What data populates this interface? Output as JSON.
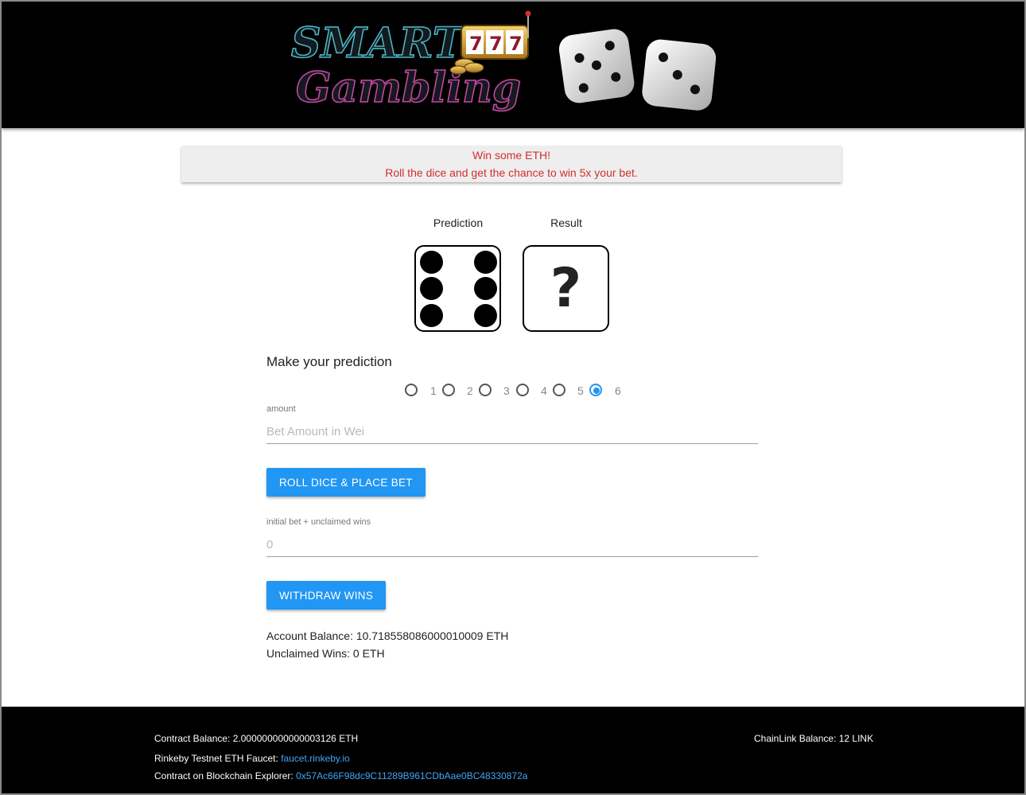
{
  "header": {
    "logo_line1": "SMART",
    "logo_line2": "Gambling",
    "slot_digits": "777",
    "dice_count": 2
  },
  "banner": {
    "line1": "Win some ETH!",
    "line2": "Roll the dice and get the chance to win 5x your bet.",
    "color": "#d32f2f"
  },
  "dice": {
    "prediction_label": "Prediction",
    "result_label": "Result",
    "prediction_value": 6,
    "result_value": "?"
  },
  "prediction": {
    "title": "Make your prediction",
    "options": [
      "1",
      "2",
      "3",
      "4",
      "5",
      "6"
    ],
    "selected": "6",
    "accent": "#2196f3"
  },
  "amount": {
    "label": "amount",
    "placeholder": "Bet Amount in Wei",
    "value": ""
  },
  "roll_button": {
    "label": "ROLL DICE & PLACE BET"
  },
  "wins_field": {
    "label": "initial bet + unclaimed wins",
    "placeholder": "0",
    "value": ""
  },
  "withdraw_button": {
    "label": "WITHDRAW WINS"
  },
  "account": {
    "balance": "Account Balance: 10.718558086000010009 ETH",
    "unclaimed": "Unclaimed Wins: 0 ETH"
  },
  "footer": {
    "contract_balance": "Contract Balance: 2.000000000000003126 ETH",
    "chainlink_balance": "ChainLink Balance: 12 LINK",
    "faucet_prefix": "Rinkeby Testnet ETH Faucet:",
    "faucet_link": "faucet.rinkeby.io",
    "explorer_prefix": "Contract on Blockchain Explorer:",
    "explorer_link": "0x57Ac66F98dc9C11289B961CDbAae0BC48330872a",
    "link_color": "#42a5f5"
  }
}
